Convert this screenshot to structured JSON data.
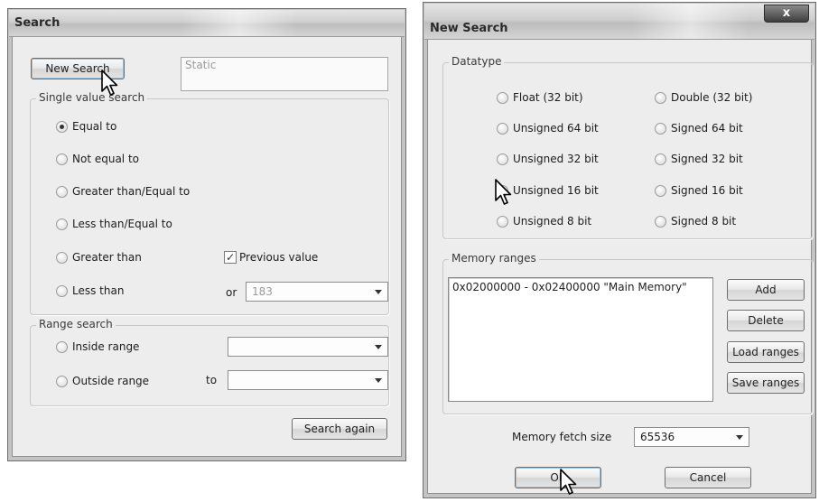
{
  "search_window": {
    "title": "Search",
    "new_search_label": "New Search",
    "static_placeholder": "Static",
    "single_value_legend": "Single value search",
    "options": [
      {
        "label": "Equal to",
        "selected": true
      },
      {
        "label": "Not equal to",
        "selected": false
      },
      {
        "label": "Greater than/Equal to",
        "selected": false
      },
      {
        "label": "Less than/Equal to",
        "selected": false
      },
      {
        "label": "Greater than",
        "selected": false
      },
      {
        "label": "Less than",
        "selected": false
      }
    ],
    "previous_value_label": "Previous value",
    "previous_value_checked": true,
    "or_label": "or",
    "value_field": "183",
    "range_legend": "Range search",
    "range_options": [
      {
        "label": "Inside range",
        "selected": false
      },
      {
        "label": "Outside range",
        "selected": false
      }
    ],
    "to_label": "to",
    "search_again_label": "Search again"
  },
  "new_search_window": {
    "title": "New Search",
    "close_label": "x",
    "datatype_legend": "Datatype",
    "datatypes": [
      {
        "label": "Float (32 bit)",
        "selected": false
      },
      {
        "label": "Double (32 bit)",
        "selected": false
      },
      {
        "label": "Unsigned 64 bit",
        "selected": false
      },
      {
        "label": "Signed 64 bit",
        "selected": false
      },
      {
        "label": "Unsigned 32 bit",
        "selected": false
      },
      {
        "label": "Signed 32 bit",
        "selected": false
      },
      {
        "label": "Unsigned 16 bit",
        "selected": false
      },
      {
        "label": "Signed 16 bit",
        "selected": false
      },
      {
        "label": "Unsigned 8 bit",
        "selected": false
      },
      {
        "label": "Signed 8 bit",
        "selected": false
      }
    ],
    "memory_legend": "Memory ranges",
    "memory_ranges": [
      "0x02000000 - 0x02400000 \"Main Memory\""
    ],
    "add_label": "Add",
    "delete_label": "Delete",
    "load_label": "Load ranges",
    "save_label": "Save ranges",
    "fetch_size_label": "Memory fetch size",
    "fetch_size_value": "65536",
    "ok_label": "OK",
    "cancel_label": "Cancel"
  },
  "icons": [
    "mouse-cursor-icon",
    "close-icon",
    "dropdown-arrow-icon",
    "checkmark-icon"
  ]
}
